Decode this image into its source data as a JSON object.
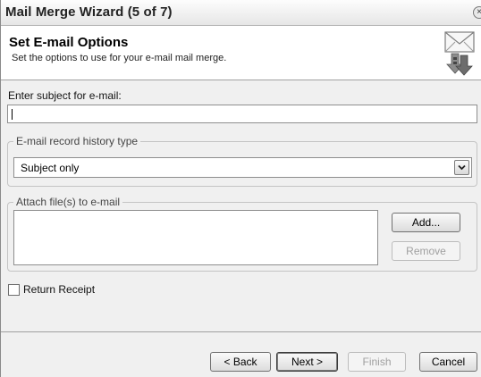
{
  "window": {
    "title": "Mail Merge Wizard (5 of 7)",
    "close_glyph": "×"
  },
  "header": {
    "title": "Set E-mail Options",
    "subtitle": "Set the options to use for your e-mail mail merge.",
    "icon": "envelope-with-arrow-icon"
  },
  "subject": {
    "label": "Enter subject for e-mail:",
    "value": ""
  },
  "history": {
    "group_label": "E-mail record history type",
    "selected": "Subject only"
  },
  "attach": {
    "group_label": "Attach file(s) to e-mail",
    "add_label": "Add...",
    "remove_label": "Remove"
  },
  "receipt": {
    "label": "Return Receipt",
    "checked": false
  },
  "footer": {
    "back_label": "< Back",
    "next_label": "Next >",
    "finish_label": "Finish",
    "cancel_label": "Cancel"
  }
}
